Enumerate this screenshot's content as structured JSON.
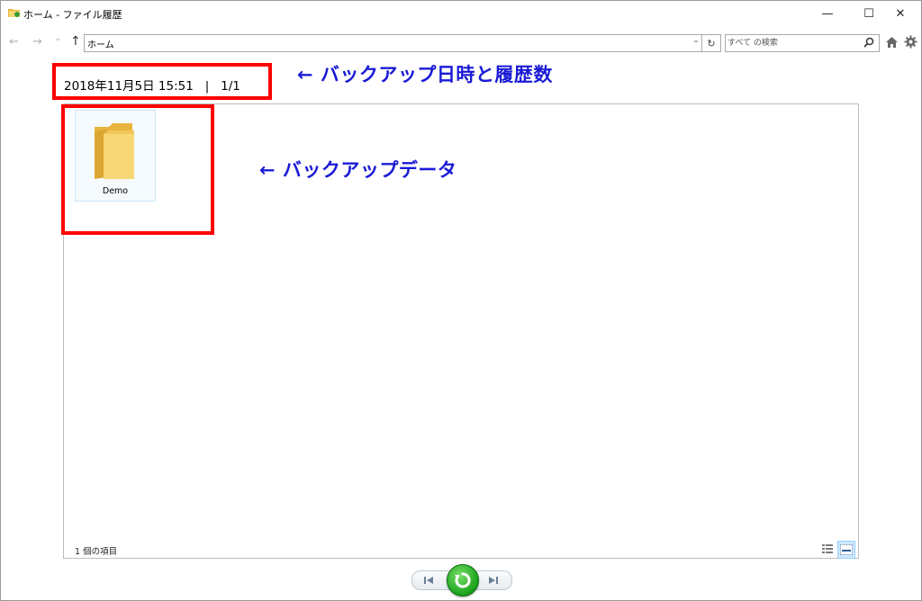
{
  "window": {
    "title": "ホーム - ファイル履歴",
    "minimize": "—",
    "maximize": "☐",
    "close": "✕"
  },
  "nav": {
    "back": "←",
    "forward": "→",
    "recent": "⌄",
    "up": "↑",
    "address": "ホーム",
    "address_dropdown": "⌄",
    "refresh": "↻",
    "search_placeholder": "すべて の検索"
  },
  "header": {
    "datetime": "2018年11月5日 15:51",
    "separator": "|",
    "history_index": "1/1"
  },
  "content": {
    "items": [
      {
        "label": "Demo",
        "icon": "folder-icon"
      }
    ],
    "status": "1 個の項目"
  },
  "annotations": {
    "header_note": "← バックアップ日時と履歴数",
    "data_note": "← バックアップデータ"
  },
  "colors": {
    "annotation_box": "#ff0000",
    "annotation_text": "#1a1ad6",
    "restore_button": "#19a11a",
    "folder": "#f8d776"
  }
}
